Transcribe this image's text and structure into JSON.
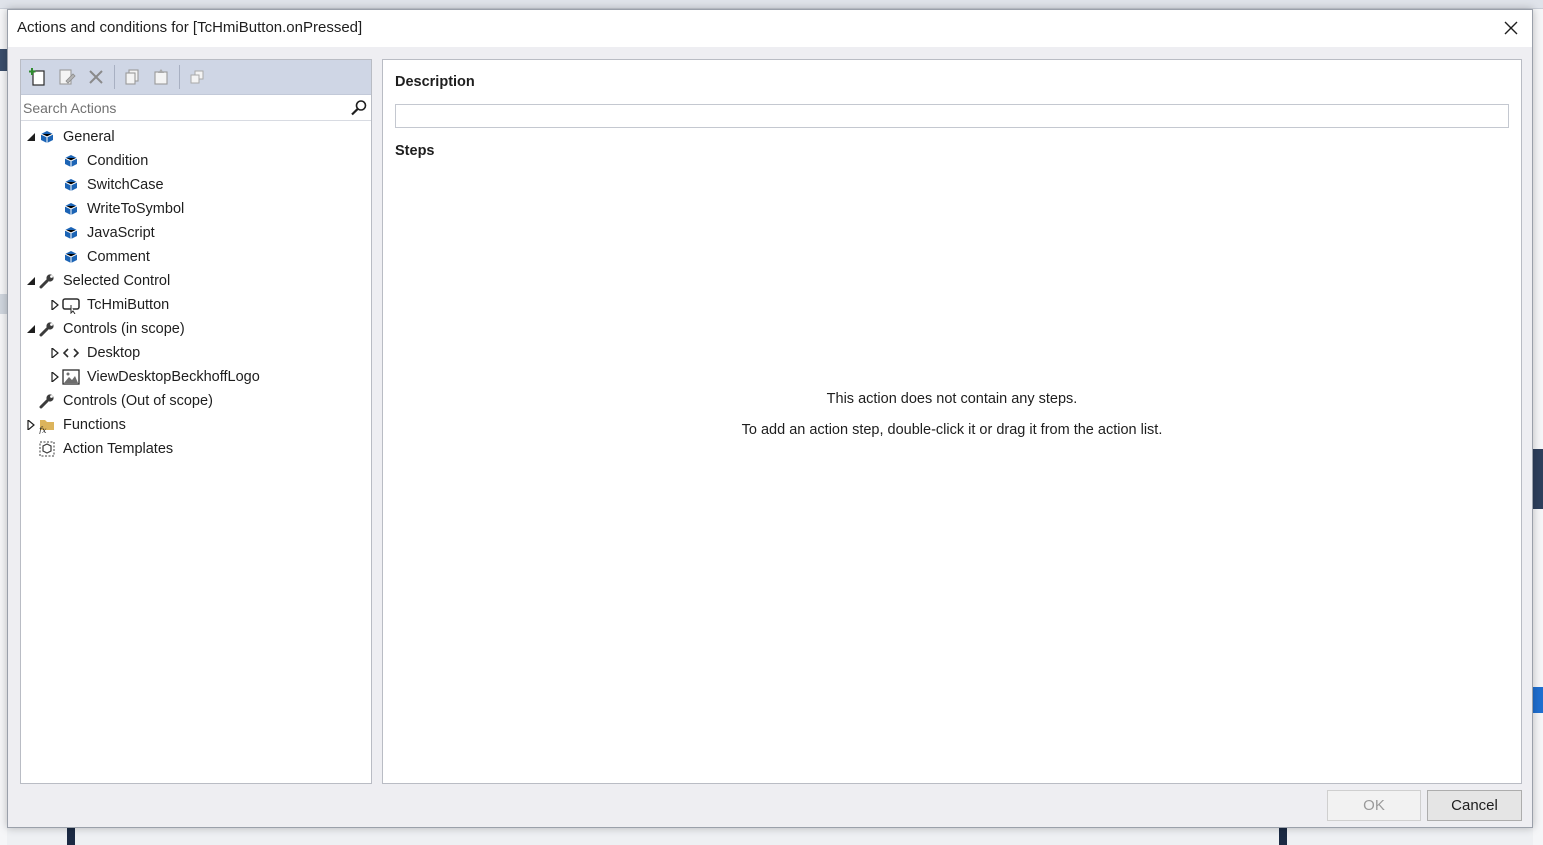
{
  "dialog": {
    "title": "Actions and conditions for [TcHmiButton.onPressed]"
  },
  "toolbar": {
    "buttons": [
      "new-action-icon",
      "edit-icon",
      "delete-icon",
      "copy-icon",
      "paste-icon",
      "duplicate-icon"
    ]
  },
  "search": {
    "placeholder": "Search Actions"
  },
  "tree": {
    "general": "General",
    "condition": "Condition",
    "switchcase": "SwitchCase",
    "writetosymbol": "WriteToSymbol",
    "javascript": "JavaScript",
    "comment": "Comment",
    "selected_control": "Selected Control",
    "tchmibutton": "TcHmiButton",
    "controls_in_scope": "Controls (in scope)",
    "desktop": "Desktop",
    "view_logo": "ViewDesktopBeckhoffLogo",
    "controls_out_scope": "Controls (Out of scope)",
    "functions": "Functions",
    "action_templates": "Action Templates"
  },
  "main": {
    "description_label": "Description",
    "description_value": "",
    "steps_label": "Steps",
    "empty_line1": "This action does not contain any steps.",
    "empty_line2": "To add an action step, double-click it or drag it from the action list."
  },
  "footer": {
    "ok_label": "OK",
    "cancel_label": "Cancel"
  },
  "colors": {
    "toolbar_bg": "#cfd6e5",
    "action_icon": "#1c64b5",
    "dialog_bg": "#eeeef2"
  }
}
